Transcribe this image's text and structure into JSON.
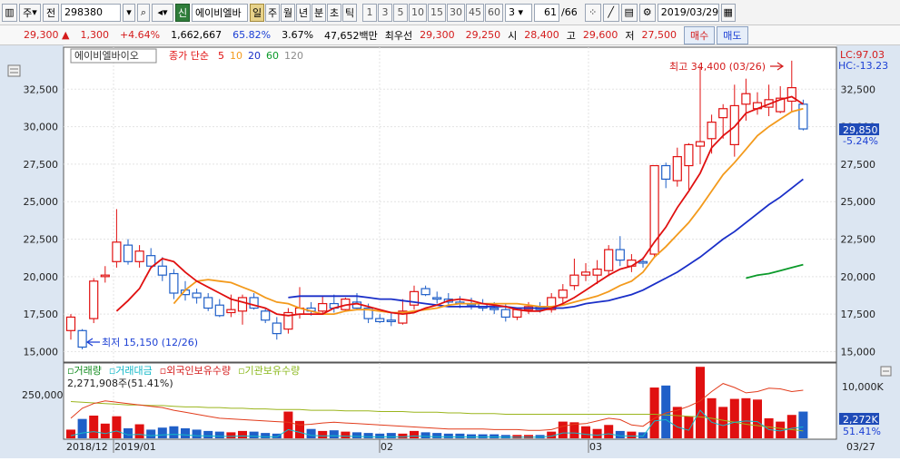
{
  "toolbar": {
    "type_label": "주",
    "jeon_label": "전",
    "code": "298380",
    "badge": "신",
    "name": "에이비엘바",
    "periods": [
      "일",
      "주",
      "월",
      "년",
      "분",
      "초",
      "틱"
    ],
    "active_period": "일",
    "intervals": [
      "1",
      "3",
      "5",
      "10",
      "15",
      "30",
      "45",
      "60"
    ],
    "interval_select": "3",
    "page": "61",
    "page_total": "/66",
    "date": "2019/03/29"
  },
  "quote": {
    "price": "29,300",
    "arrow": "▲",
    "change": "1,300",
    "change_pct": "+4.64%",
    "volume": "1,662,667",
    "vol_ratio": "65.82%",
    "turnover": "3.67%",
    "amount": "47,652백만",
    "best_label": "최우선",
    "ask": "29,300",
    "bid": "29,250",
    "open_label": "시",
    "open": "28,400",
    "high_label": "고",
    "high": "29,600",
    "low_label": "저",
    "low": "27,500",
    "buy_label": "매수",
    "sell_label": "매도"
  },
  "legend": {
    "name": "에이비엘바이오",
    "ma_label": "종가 단순",
    "ma": [
      {
        "period": "5",
        "color": "#e01010"
      },
      {
        "period": "10",
        "color": "#f39a1c"
      },
      {
        "period": "20",
        "color": "#1a2fc8"
      },
      {
        "period": "60",
        "color": "#0b9a2a"
      },
      {
        "period": "120",
        "color": "#8c8c8c"
      }
    ]
  },
  "annotations": {
    "max_label": "최고 34,400 (03/26)",
    "min_label": "최저 15,150 (12/26)",
    "lc": "LC:97.03",
    "hc": "HC:-13.23",
    "price_tag": "29,850",
    "price_tag_pct": "-5.24%"
  },
  "volume_panel": {
    "legend": [
      {
        "label": "거래량",
        "color": "#0e8a1b"
      },
      {
        "label": "거래대금",
        "color": "#12b8c8"
      },
      {
        "label": "외국인보유수량",
        "color": "#d41b1b"
      },
      {
        "label": "기관보유수량",
        "color": "#8ab81b"
      }
    ],
    "info": "2,271,908주(51.41%)",
    "left_tick": "250,000",
    "right_tick": "10,000K",
    "tag_vol": "2,272K",
    "tag_pct": "51.41%"
  },
  "x_axis": [
    "2018/12",
    "2019/01",
    "02",
    "03"
  ],
  "x_axis_right": "03/27",
  "chart_data": {
    "type": "candlestick",
    "y_ticks": [
      15000,
      17500,
      20000,
      22500,
      25000,
      27500,
      30000,
      32500
    ],
    "ylim": [
      14300,
      35300
    ],
    "candles": [
      {
        "o": 16400,
        "h": 17500,
        "l": 15800,
        "c": 17300
      },
      {
        "o": 16400,
        "h": 16500,
        "l": 15150,
        "c": 15300
      },
      {
        "o": 17200,
        "h": 19900,
        "l": 16900,
        "c": 19700
      },
      {
        "o": 20000,
        "h": 20700,
        "l": 19600,
        "c": 20100
      },
      {
        "o": 21000,
        "h": 24500,
        "l": 20600,
        "c": 22300
      },
      {
        "o": 22100,
        "h": 22500,
        "l": 20800,
        "c": 21000
      },
      {
        "o": 21000,
        "h": 22100,
        "l": 20600,
        "c": 21700
      },
      {
        "o": 21400,
        "h": 21900,
        "l": 20600,
        "c": 20700
      },
      {
        "o": 20700,
        "h": 21300,
        "l": 19700,
        "c": 20100
      },
      {
        "o": 20200,
        "h": 20500,
        "l": 18500,
        "c": 18900
      },
      {
        "o": 19100,
        "h": 19700,
        "l": 18400,
        "c": 18800
      },
      {
        "o": 18900,
        "h": 19200,
        "l": 18200,
        "c": 18600
      },
      {
        "o": 18600,
        "h": 18900,
        "l": 17700,
        "c": 17900
      },
      {
        "o": 18100,
        "h": 18500,
        "l": 17300,
        "c": 17400
      },
      {
        "o": 17600,
        "h": 18800,
        "l": 17300,
        "c": 17800
      },
      {
        "o": 17700,
        "h": 18800,
        "l": 16800,
        "c": 18600
      },
      {
        "o": 18600,
        "h": 18900,
        "l": 17800,
        "c": 17900
      },
      {
        "o": 17700,
        "h": 17900,
        "l": 16900,
        "c": 17100
      },
      {
        "o": 16900,
        "h": 17300,
        "l": 15800,
        "c": 16200
      },
      {
        "o": 16500,
        "h": 17900,
        "l": 16200,
        "c": 17600
      },
      {
        "o": 17500,
        "h": 19300,
        "l": 17200,
        "c": 17900
      },
      {
        "o": 17900,
        "h": 18300,
        "l": 17400,
        "c": 17700
      },
      {
        "o": 17700,
        "h": 18700,
        "l": 17500,
        "c": 18200
      },
      {
        "o": 18200,
        "h": 18800,
        "l": 17600,
        "c": 17900
      },
      {
        "o": 17800,
        "h": 18600,
        "l": 17700,
        "c": 18500
      },
      {
        "o": 18300,
        "h": 18900,
        "l": 17800,
        "c": 17900
      },
      {
        "o": 17900,
        "h": 18200,
        "l": 16900,
        "c": 17200
      },
      {
        "o": 17200,
        "h": 17500,
        "l": 16900,
        "c": 17000
      },
      {
        "o": 17100,
        "h": 17600,
        "l": 16700,
        "c": 17000
      },
      {
        "o": 16900,
        "h": 18500,
        "l": 16800,
        "c": 17700
      },
      {
        "o": 18100,
        "h": 19400,
        "l": 17800,
        "c": 19000
      },
      {
        "o": 19200,
        "h": 19400,
        "l": 18700,
        "c": 18800
      },
      {
        "o": 18600,
        "h": 19000,
        "l": 18200,
        "c": 18500
      },
      {
        "o": 18500,
        "h": 18900,
        "l": 18100,
        "c": 18300
      },
      {
        "o": 18300,
        "h": 18700,
        "l": 17900,
        "c": 18200
      },
      {
        "o": 18200,
        "h": 18600,
        "l": 17800,
        "c": 18100
      },
      {
        "o": 18200,
        "h": 18500,
        "l": 17700,
        "c": 17900
      },
      {
        "o": 17900,
        "h": 18300,
        "l": 17500,
        "c": 17800
      },
      {
        "o": 17800,
        "h": 18200,
        "l": 17000,
        "c": 17300
      },
      {
        "o": 17300,
        "h": 17900,
        "l": 17100,
        "c": 17800
      },
      {
        "o": 17800,
        "h": 18300,
        "l": 17500,
        "c": 18000
      },
      {
        "o": 18000,
        "h": 18300,
        "l": 17600,
        "c": 17800
      },
      {
        "o": 17800,
        "h": 18900,
        "l": 17600,
        "c": 18600
      },
      {
        "o": 18600,
        "h": 19500,
        "l": 18200,
        "c": 19100
      },
      {
        "o": 19400,
        "h": 21200,
        "l": 19100,
        "c": 20100
      },
      {
        "o": 20100,
        "h": 20900,
        "l": 19700,
        "c": 20300
      },
      {
        "o": 20100,
        "h": 21100,
        "l": 19500,
        "c": 20500
      },
      {
        "o": 20400,
        "h": 22100,
        "l": 20100,
        "c": 21800
      },
      {
        "o": 21800,
        "h": 22700,
        "l": 20700,
        "c": 21100
      },
      {
        "o": 20700,
        "h": 21500,
        "l": 20300,
        "c": 21100
      },
      {
        "o": 21000,
        "h": 21300,
        "l": 20600,
        "c": 20900
      },
      {
        "o": 21500,
        "h": 27400,
        "l": 21300,
        "c": 27400
      },
      {
        "o": 27400,
        "h": 27600,
        "l": 25900,
        "c": 26500
      },
      {
        "o": 26400,
        "h": 28600,
        "l": 26000,
        "c": 28000
      },
      {
        "o": 27400,
        "h": 28900,
        "l": 25800,
        "c": 28800
      },
      {
        "o": 28700,
        "h": 34000,
        "l": 27500,
        "c": 29000
      },
      {
        "o": 29200,
        "h": 30800,
        "l": 28200,
        "c": 30300
      },
      {
        "o": 30600,
        "h": 31500,
        "l": 29200,
        "c": 31200
      },
      {
        "o": 28800,
        "h": 32800,
        "l": 28000,
        "c": 31400
      },
      {
        "o": 31500,
        "h": 33200,
        "l": 30400,
        "c": 32200
      },
      {
        "o": 31200,
        "h": 32300,
        "l": 30800,
        "c": 31600
      },
      {
        "o": 31300,
        "h": 32800,
        "l": 30700,
        "c": 31800
      },
      {
        "o": 31000,
        "h": 32700,
        "l": 30900,
        "c": 31900
      },
      {
        "o": 31700,
        "h": 34400,
        "l": 31000,
        "c": 32600
      },
      {
        "o": 31500,
        "h": 31800,
        "l": 29750,
        "c": 29850
      }
    ],
    "ma5": [
      null,
      null,
      null,
      null,
      17700,
      18400,
      19200,
      20600,
      21200,
      21000,
      20300,
      19700,
      19300,
      18900,
      18500,
      18300,
      18100,
      17900,
      17500,
      17400,
      17500,
      17500,
      17500,
      17900,
      18100,
      18200,
      18000,
      17800,
      17600,
      17500,
      17600,
      17900,
      18100,
      18400,
      18500,
      18400,
      18200,
      18100,
      18000,
      17800,
      17700,
      17700,
      17900,
      18200,
      18600,
      19100,
      19600,
      20100,
      20500,
      20700,
      21200,
      22300,
      23300,
      24600,
      25700,
      26900,
      28600,
      29400,
      30000,
      30900,
      31200,
      31500,
      31800,
      32000,
      31500
    ],
    "ma10": [
      null,
      null,
      null,
      null,
      null,
      null,
      null,
      null,
      null,
      18200,
      19100,
      19700,
      19800,
      19700,
      19600,
      19300,
      19000,
      18600,
      18300,
      18200,
      17900,
      17700,
      17500,
      17500,
      17700,
      17800,
      17800,
      17700,
      17600,
      17600,
      17700,
      17800,
      17900,
      18100,
      18200,
      18200,
      18200,
      18200,
      18200,
      18200,
      18100,
      18000,
      18000,
      18100,
      18300,
      18500,
      18700,
      19000,
      19400,
      19700,
      20300,
      21300,
      22000,
      22800,
      23600,
      24600,
      25700,
      26800,
      27600,
      28500,
      29400,
      30000,
      30500,
      31000,
      31200
    ],
    "ma20": [
      null,
      null,
      null,
      null,
      null,
      null,
      null,
      null,
      null,
      null,
      null,
      null,
      null,
      null,
      null,
      null,
      null,
      null,
      null,
      18600,
      18700,
      18700,
      18700,
      18700,
      18700,
      18700,
      18600,
      18500,
      18500,
      18400,
      18300,
      18200,
      18100,
      18000,
      18000,
      18000,
      18000,
      18000,
      18000,
      17900,
      17900,
      17900,
      17900,
      17900,
      18000,
      18200,
      18300,
      18400,
      18600,
      18800,
      19100,
      19500,
      19900,
      20300,
      20800,
      21300,
      21900,
      22500,
      23000,
      23600,
      24200,
      24800,
      25300,
      25900,
      26500
    ],
    "ma60": [
      null,
      null,
      null,
      null,
      null,
      null,
      null,
      null,
      null,
      null,
      null,
      null,
      null,
      null,
      null,
      null,
      null,
      null,
      null,
      null,
      null,
      null,
      null,
      null,
      null,
      null,
      null,
      null,
      null,
      null,
      null,
      null,
      null,
      null,
      null,
      null,
      null,
      null,
      null,
      null,
      null,
      null,
      null,
      null,
      null,
      null,
      null,
      null,
      null,
      null,
      null,
      null,
      null,
      null,
      null,
      null,
      null,
      null,
      null,
      19900,
      20100,
      20200,
      20400,
      20600,
      20800
    ],
    "volume": [
      130,
      290,
      340,
      220,
      330,
      150,
      210,
      130,
      160,
      180,
      150,
      130,
      110,
      100,
      90,
      110,
      100,
      80,
      70,
      400,
      260,
      140,
      110,
      120,
      100,
      90,
      80,
      70,
      80,
      70,
      110,
      90,
      80,
      70,
      70,
      60,
      60,
      60,
      50,
      50,
      50,
      50,
      100,
      250,
      240,
      180,
      140,
      200,
      110,
      100,
      90,
      760,
      790,
      470,
      330,
      1070,
      600,
      470,
      590,
      600,
      580,
      300,
      250,
      350,
      400
    ],
    "foreign": [
      300,
      450,
      520,
      560,
      540,
      520,
      500,
      480,
      460,
      420,
      390,
      360,
      330,
      300,
      290,
      280,
      270,
      260,
      250,
      240,
      200,
      210,
      230,
      240,
      230,
      220,
      210,
      200,
      190,
      180,
      170,
      160,
      150,
      140,
      140,
      140,
      140,
      130,
      130,
      130,
      120,
      120,
      130,
      180,
      210,
      220,
      260,
      300,
      280,
      200,
      180,
      300,
      380,
      420,
      480,
      560,
      700,
      820,
      760,
      680,
      700,
      750,
      740,
      700,
      720
    ],
    "institution": [
      550,
      540,
      530,
      520,
      510,
      500,
      500,
      490,
      490,
      480,
      470,
      470,
      460,
      460,
      450,
      450,
      440,
      440,
      430,
      430,
      430,
      420,
      420,
      420,
      410,
      410,
      410,
      400,
      400,
      400,
      390,
      390,
      390,
      380,
      380,
      370,
      370,
      370,
      360,
      360,
      360,
      360,
      360,
      360,
      360,
      360,
      360,
      360,
      360,
      360,
      360,
      360,
      350,
      340,
      330,
      320,
      300,
      270,
      240,
      210,
      190,
      170,
      150,
      130,
      110
    ],
    "turnover": [
      40,
      80,
      100,
      70,
      110,
      50,
      60,
      40,
      50,
      60,
      50,
      40,
      35,
      30,
      28,
      35,
      30,
      25,
      22,
      130,
      90,
      45,
      35,
      40,
      32,
      28,
      25,
      22,
      25,
      22,
      35,
      28,
      25,
      22,
      22,
      20,
      20,
      20,
      16,
      16,
      16,
      16,
      32,
      80,
      80,
      60,
      46,
      68,
      38,
      34,
      30,
      260,
      280,
      170,
      120,
      420,
      240,
      190,
      240,
      260,
      250,
      130,
      110,
      150,
      170
    ]
  }
}
